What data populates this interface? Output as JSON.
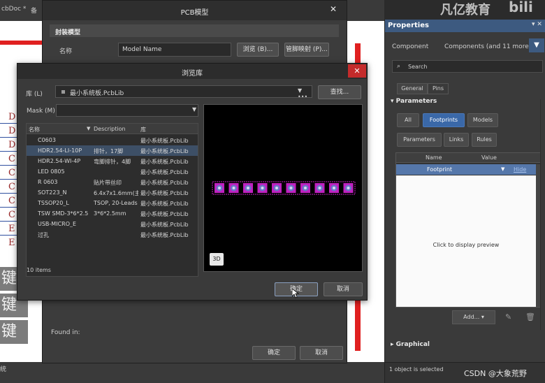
{
  "background": {
    "tab_label": "cbDoc *",
    "tab_label2": "备",
    "letters": [
      "D",
      "D",
      "D",
      "C",
      "C",
      "C",
      "C",
      "C",
      "E",
      "E"
    ],
    "overlay_text": [
      "键",
      "键",
      "键"
    ],
    "bottom_label": "统"
  },
  "pcb_dialog": {
    "title": "PCB模型",
    "section": "封装模型",
    "name_label": "名称",
    "name_value": "Model Name",
    "browse_button": "浏览 (B)...",
    "pinmap_button": "管脚映射 (P)...",
    "found_in": "Found in:",
    "ok": "确定",
    "cancel": "取消"
  },
  "browse_dialog": {
    "title": "浏览库",
    "library_label": "库 (L)",
    "library_value": "最小系统板.PcbLib",
    "find_button": "查找...",
    "mask_label": "Mask (M)",
    "columns": [
      "名称",
      "Description",
      "库"
    ],
    "rows": [
      {
        "name": "C0603",
        "desc": "",
        "lib": "最小系统板.PcbLib"
      },
      {
        "name": "HDR2.54-LI-10P",
        "desc": "排针，17脚",
        "lib": "最小系统板.PcbLib"
      },
      {
        "name": "HDR2.54-WI-4P",
        "desc": "弯脚排针，4脚",
        "lib": "最小系统板.PcbLib"
      },
      {
        "name": "LED 0805",
        "desc": "",
        "lib": "最小系统板.PcbLib"
      },
      {
        "name": "R 0603",
        "desc": "贴片带丝印",
        "lib": "最小系统板.PcbLib"
      },
      {
        "name": "SOT223_N",
        "desc": "6.4x7x1.6mm(主",
        "lib": "最小系统板.PcbLib"
      },
      {
        "name": "TSSOP20_L",
        "desc": "TSOP, 20-Leads",
        "lib": "最小系统板.PcbLib"
      },
      {
        "name": "TSW SMD-3*6*2.5",
        "desc": "3*6*2.5mm",
        "lib": "最小系统板.PcbLib"
      },
      {
        "name": "USB-MICRO_E",
        "desc": "",
        "lib": "最小系统板.PcbLib"
      },
      {
        "name": "过孔",
        "desc": "",
        "lib": "最小系统板.PcbLib"
      }
    ],
    "selected_row": 1,
    "item_count": "10 items",
    "btn_3d": "3D",
    "ok": "确定",
    "cancel": "取消"
  },
  "properties": {
    "title": "Properties",
    "component_label": "Component",
    "component_value": "Components (and 11 more)",
    "search_placeholder": "Search",
    "tabs": [
      "General",
      "Pins"
    ],
    "section_parameters": "Parameters",
    "filters": [
      "All",
      "Footprints",
      "Models",
      "Parameters",
      "Links",
      "Rules"
    ],
    "active_filter": "Footprints",
    "table_headers": [
      "Name",
      "Value"
    ],
    "row_name": "Footprint",
    "row_hide": "Hide",
    "preview_text": "Click to display preview",
    "add_button": "Add...",
    "section_graphical": "Graphical",
    "status": "1 object is selected"
  },
  "watermark": {
    "brand": "凡亿教育",
    "bili": "bili",
    "csdn": "CSDN @大象荒野"
  },
  "colors": {
    "accent_blue": "#3a68a8",
    "close_red": "#c42b2b",
    "pad_magenta": "#c020c0",
    "schematic_red": "#e02020"
  }
}
